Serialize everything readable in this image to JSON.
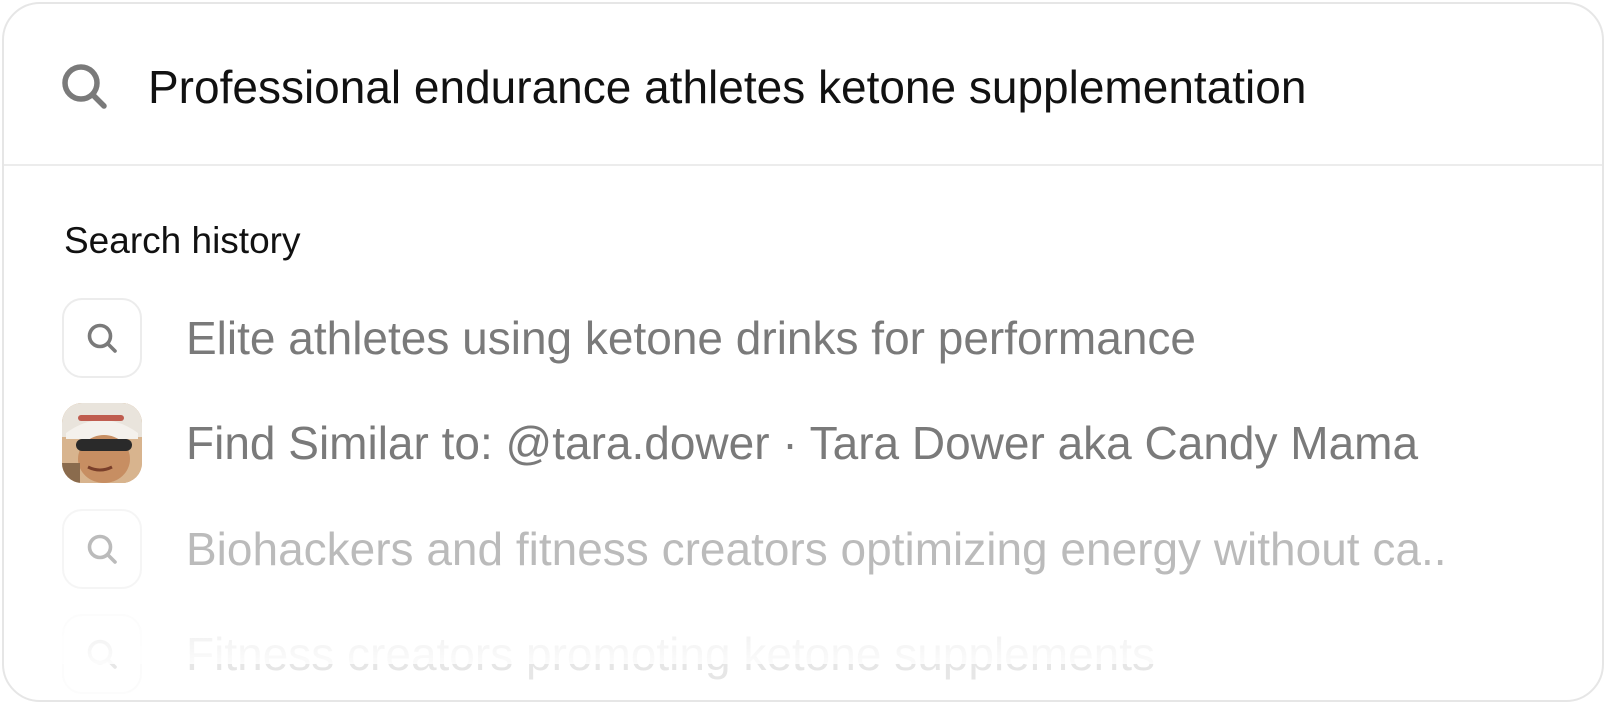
{
  "search": {
    "value": "Professional endurance athletes ketone supplementation",
    "icon": "search-icon"
  },
  "history": {
    "title": "Search history",
    "items": [
      {
        "type": "query",
        "icon": "search-icon",
        "label": "Elite athletes using ketone drinks for performance"
      },
      {
        "type": "profile",
        "icon": "avatar",
        "label": "Find Similar to: @tara.dower · Tara Dower aka Candy Mama"
      },
      {
        "type": "query",
        "icon": "search-icon",
        "label": "Biohackers and fitness creators optimizing energy without ca.."
      },
      {
        "type": "query",
        "icon": "search-icon",
        "label": "Fitness creators promoting ketone supplements"
      }
    ]
  },
  "colors": {
    "text_primary": "#111111",
    "text_muted": "#7a7a7a",
    "border": "#e6e6e6",
    "icon": "#7a7a7a"
  }
}
